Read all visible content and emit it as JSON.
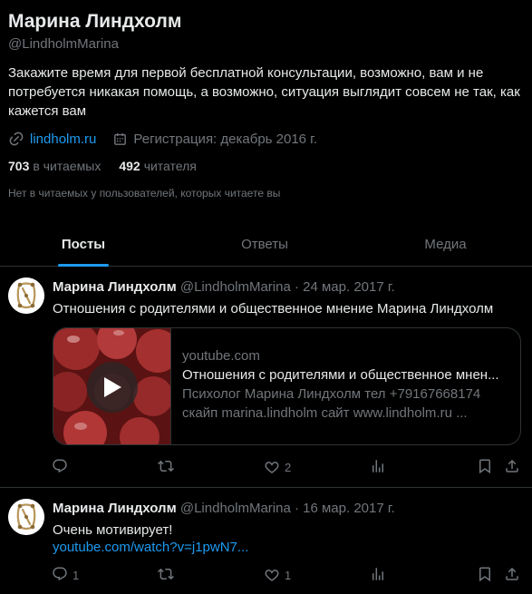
{
  "profile": {
    "name": "Марина Линдхолм",
    "handle": "@LindholmMarina",
    "bio": "Закажите время для первой бесплатной консультации, возможно, вам и не потребуется никакая помощь, а возможно, ситуация выглядит совсем не так, как кажется вам",
    "website": "lindholm.ru",
    "joined": "Регистрация: декабрь 2016 г.",
    "following_count": "703",
    "following_label": "в читаемых",
    "followers_count": "492",
    "followers_label": "читателя",
    "followers_you_know": "Нет в читаемых у пользователей, которых читаете вы"
  },
  "tabs": [
    {
      "label": "Посты",
      "active": true
    },
    {
      "label": "Ответы",
      "active": false
    },
    {
      "label": "Медиа",
      "active": false
    }
  ],
  "posts": [
    {
      "author": "Марина Линдхолм",
      "handle": "@LindholmMarina",
      "date": "· 24 мар. 2017 г.",
      "text": "Отношения с родителями и общественное мнение Марина Линдхолм",
      "card": {
        "domain": "youtube.com",
        "title": "Отношения с родителями и общественное мнен...",
        "description_line1": "Психолог Марина Линдхолм тел +79167668174",
        "description_line2": "скайп marina.lindholm сайт www.lindholm.ru ..."
      },
      "replies": "",
      "reposts": "",
      "likes": "2"
    },
    {
      "author": "Марина Линдхолм",
      "handle": "@LindholmMarina",
      "date": "· 16 мар. 2017 г.",
      "text": "Очень мотивирует!",
      "link": "youtube.com/watch?v=j1pwN7...",
      "replies": "1",
      "reposts": "",
      "likes": "1"
    }
  ],
  "colors": {
    "background": "#000000",
    "text": "#e7e9ea",
    "secondary": "#71767b",
    "accent": "#1d9bf0",
    "border": "#2f3336"
  },
  "icons": [
    "link-icon",
    "calendar-icon",
    "reply-icon",
    "repost-icon",
    "like-icon",
    "views-icon",
    "bookmark-icon",
    "share-icon",
    "play-icon"
  ]
}
